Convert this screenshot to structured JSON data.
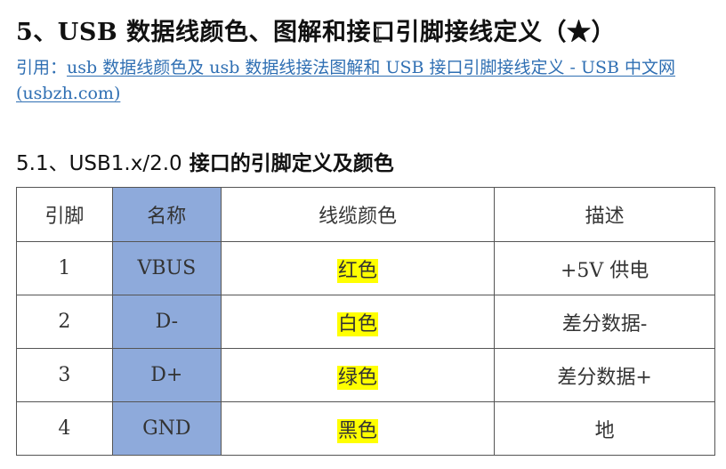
{
  "section_title": "5、USB 数据线颜色、图解和接口引脚接线定义（★）",
  "reference": {
    "prefix": "引用：",
    "link_text": "usb 数据线颜色及 usb 数据线接法图解和 USB 接口引脚接线定义 - USB 中文网 (usbzh.com)"
  },
  "subsection": {
    "number": "5.1、USB1.x/2.0",
    "title": " 接口的引脚定义及颜色"
  },
  "table": {
    "headers": [
      "引脚",
      "名称",
      "线缆颜色",
      "描述"
    ],
    "rows": [
      {
        "pin": "1",
        "name": "VBUS",
        "color": "红色",
        "desc": "+5V 供电"
      },
      {
        "pin": "2",
        "name": "D-",
        "color": "白色",
        "desc": "差分数据-"
      },
      {
        "pin": "3",
        "name": "D+",
        "color": "绿色",
        "desc": "差分数据+"
      },
      {
        "pin": "4",
        "name": "GND",
        "color": "黑色",
        "desc": "地"
      }
    ]
  },
  "colors": {
    "name_column_bg": "#8eaadb",
    "highlight": "#ffff00",
    "link": "#2f6fb3"
  },
  "icons": {
    "cursor": "text-cursor-icon"
  }
}
